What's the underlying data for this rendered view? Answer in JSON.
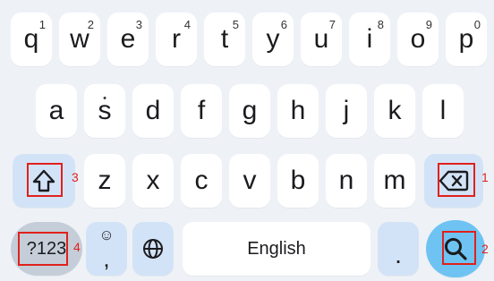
{
  "rows": {
    "row1": [
      {
        "letter": "q",
        "sup": "1"
      },
      {
        "letter": "w",
        "sup": "2"
      },
      {
        "letter": "e",
        "sup": "3"
      },
      {
        "letter": "r",
        "sup": "4"
      },
      {
        "letter": "t",
        "sup": "5"
      },
      {
        "letter": "y",
        "sup": "6"
      },
      {
        "letter": "u",
        "sup": "7"
      },
      {
        "letter": "i",
        "sup": "8"
      },
      {
        "letter": "o",
        "sup": "9"
      },
      {
        "letter": "p",
        "sup": "0"
      }
    ],
    "row2": [
      {
        "letter": "a"
      },
      {
        "letter": "s",
        "dot": "•"
      },
      {
        "letter": "d"
      },
      {
        "letter": "f"
      },
      {
        "letter": "g"
      },
      {
        "letter": "h"
      },
      {
        "letter": "j"
      },
      {
        "letter": "k"
      },
      {
        "letter": "l"
      }
    ],
    "row3": [
      {
        "letter": "z"
      },
      {
        "letter": "x"
      },
      {
        "letter": "c"
      },
      {
        "letter": "v"
      },
      {
        "letter": "b"
      },
      {
        "letter": "n"
      },
      {
        "letter": "m"
      }
    ]
  },
  "bottom": {
    "symbols_label": "?123",
    "emoji_face": "☺",
    "comma": ",",
    "space_label": "English",
    "period": "."
  },
  "annotations": {
    "backspace": "1",
    "search": "2",
    "shift": "3",
    "symbols": "4"
  },
  "icons": {
    "shift": "shift-arrow-icon",
    "backspace": "backspace-icon",
    "globe": "globe-icon",
    "search": "search-icon",
    "emoji": "emoji-icon"
  },
  "colors": {
    "background": "#eef2f7",
    "key": "#ffffff",
    "function_key": "#d3e3f7",
    "search_key": "#6ec3f3",
    "annotation": "#e0211b"
  }
}
